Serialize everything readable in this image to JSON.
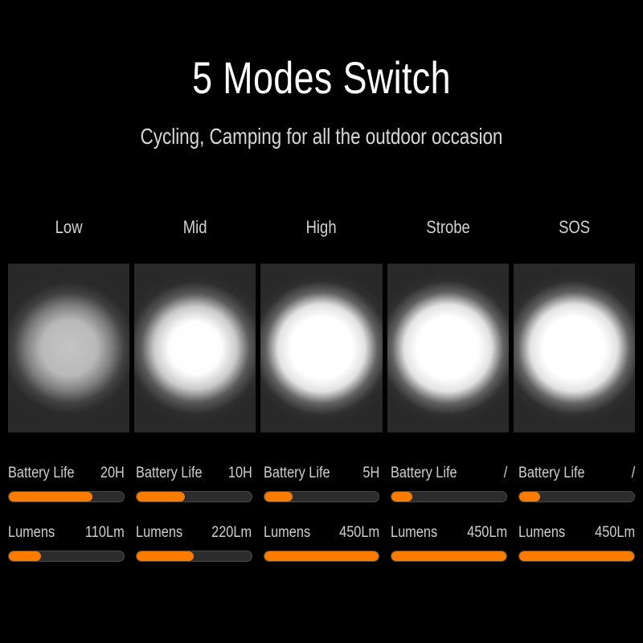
{
  "header": {
    "title": "5 Modes Switch",
    "subtitle": "Cycling, Camping for all the outdoor occasion"
  },
  "theme": {
    "background": "#000000",
    "accent_orange": "#F97C00",
    "panel_background": "#292929",
    "track_background": "#2c2c2c",
    "text_color": "#cfcfcf",
    "title_color": "#ffffff"
  },
  "stat_labels": {
    "battery": "Battery Life",
    "lumens": "Lumens"
  },
  "modes": [
    {
      "id": "low",
      "label": "Low",
      "beam_intensity": "dim",
      "battery_life": "20H",
      "battery_percent": 73,
      "lumens": "110Lm",
      "lumens_percent": 28
    },
    {
      "id": "mid",
      "label": "Mid",
      "beam_intensity": "bright",
      "battery_life": "10H",
      "battery_percent": 42,
      "lumens": "220Lm",
      "lumens_percent": 50
    },
    {
      "id": "high",
      "label": "High",
      "beam_intensity": "brightest",
      "battery_life": "5H",
      "battery_percent": 25,
      "lumens": "450Lm",
      "lumens_percent": 100
    },
    {
      "id": "strobe",
      "label": "Strobe",
      "beam_intensity": "brightest",
      "battery_life": "/",
      "battery_percent": 18,
      "lumens": "450Lm",
      "lumens_percent": 100
    },
    {
      "id": "sos",
      "label": "SOS",
      "beam_intensity": "brightest",
      "battery_life": "/",
      "battery_percent": 18,
      "lumens": "450Lm",
      "lumens_percent": 100
    }
  ]
}
